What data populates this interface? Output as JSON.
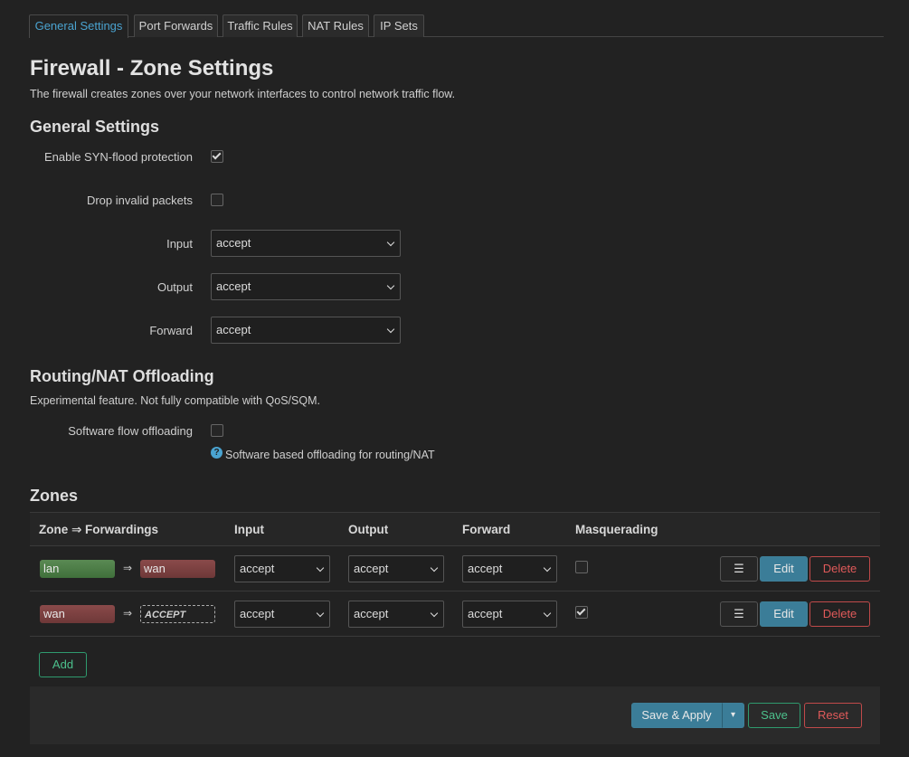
{
  "tabs": [
    "General Settings",
    "Port Forwards",
    "Traffic Rules",
    "NAT Rules",
    "IP Sets"
  ],
  "page": {
    "title": "Firewall - Zone Settings",
    "description": "The firewall creates zones over your network interfaces to control network traffic flow."
  },
  "general": {
    "heading": "General Settings",
    "syn_flood_label": "Enable SYN-flood protection",
    "syn_flood_checked": true,
    "drop_invalid_label": "Drop invalid packets",
    "drop_invalid_checked": false,
    "input_label": "Input",
    "input_value": "accept",
    "output_label": "Output",
    "output_value": "accept",
    "forward_label": "Forward",
    "forward_value": "accept"
  },
  "offload": {
    "heading": "Routing/NAT Offloading",
    "description": "Experimental feature. Not fully compatible with QoS/SQM.",
    "software_label": "Software flow offloading",
    "software_checked": false,
    "help_icon": "question-circle-icon",
    "help_text": "Software based offloading for routing/NAT"
  },
  "zones": {
    "heading": "Zones",
    "columns": [
      "Zone ⇒ Forwardings",
      "Input",
      "Output",
      "Forward",
      "Masquerading"
    ],
    "arrow": "⇒",
    "rows": [
      {
        "zone": "lan",
        "forward_to": "wan",
        "input": "accept",
        "output": "accept",
        "forward": "accept",
        "masquerading": false
      },
      {
        "zone": "wan",
        "forward_to": "ACCEPT",
        "input": "accept",
        "output": "accept",
        "forward": "accept",
        "masquerading": true
      }
    ],
    "menu_icon": "☰",
    "edit_label": "Edit",
    "delete_label": "Delete",
    "add_label": "Add"
  },
  "footer": {
    "save_apply_label": "Save & Apply",
    "dropdown_icon": "▾",
    "save_label": "Save",
    "reset_label": "Reset"
  },
  "colors": {
    "accent": "#4aa3d0",
    "lan_zone": "#4f7f49",
    "wan_zone": "#7c4040",
    "positive": "#4cc08c",
    "negative": "#e05a5a"
  }
}
